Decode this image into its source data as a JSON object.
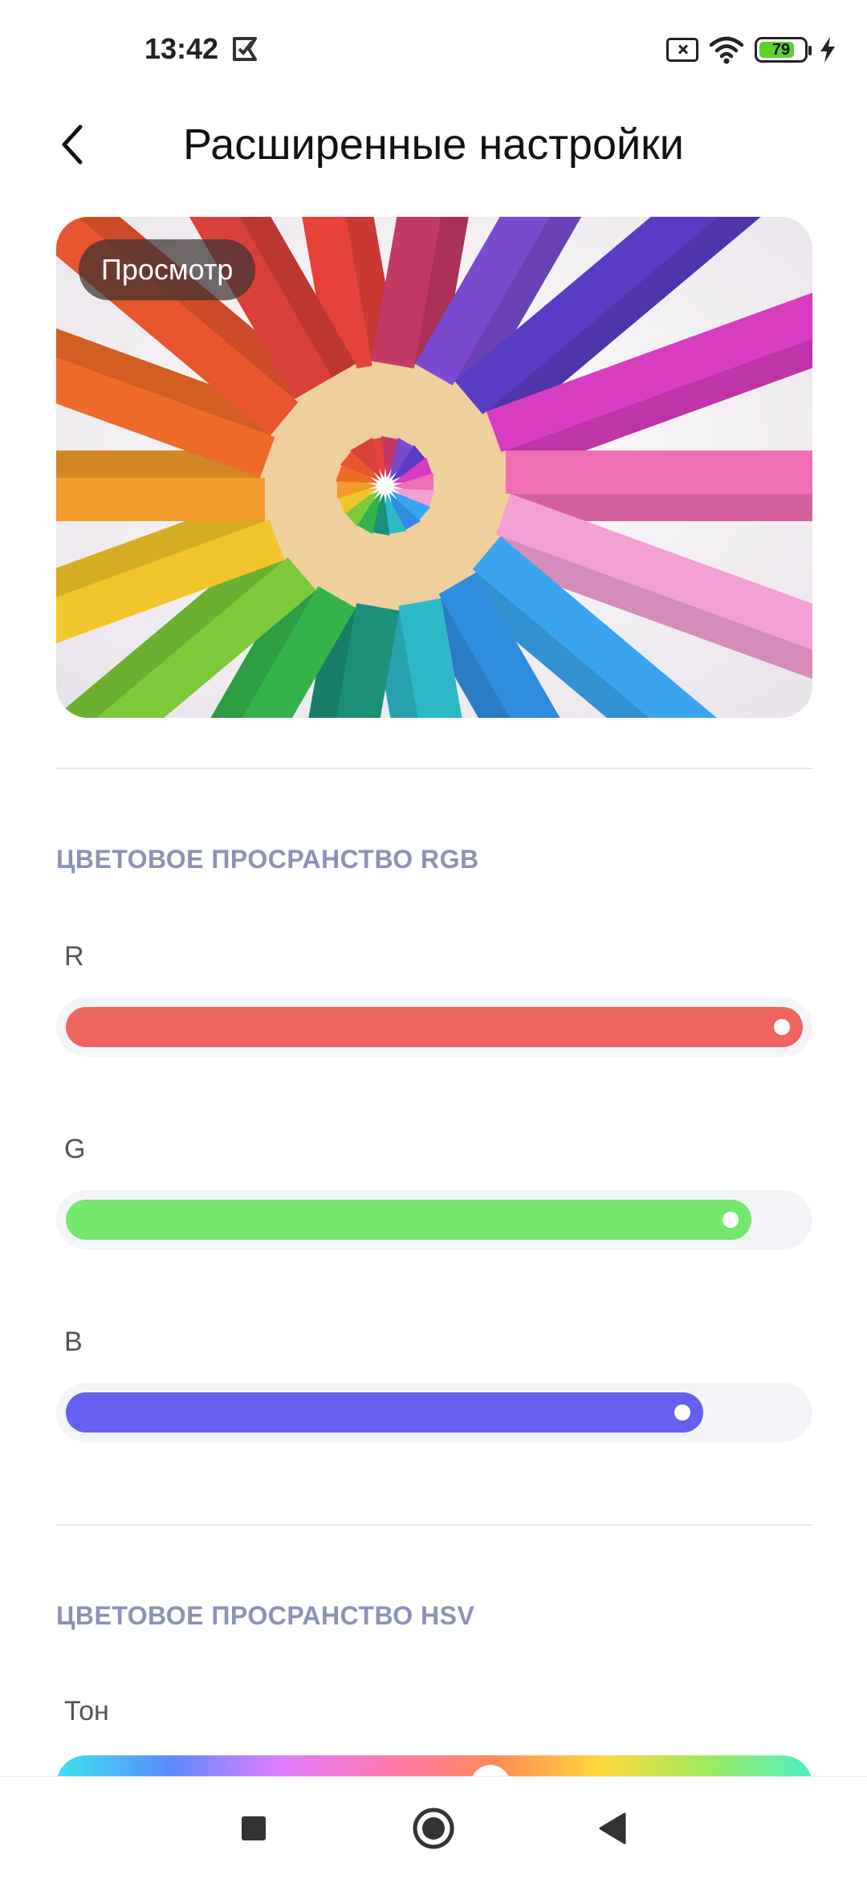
{
  "status_bar": {
    "time": "13:42",
    "battery": "79",
    "battery_color": "#5cd12f"
  },
  "header": {
    "title": "Расширенные настройки"
  },
  "preview": {
    "badge": "Просмотр"
  },
  "rgb_section": {
    "title": "ЦВЕТОВОЕ ПРОСРАНСТВО RGB",
    "sliders": [
      {
        "label": "R",
        "value_fraction": 1.0,
        "color": "#ef6660"
      },
      {
        "label": "G",
        "value_fraction": 0.93,
        "color": "#74e86f"
      },
      {
        "label": "B",
        "value_fraction": 0.865,
        "color": "#6560ef"
      }
    ]
  },
  "hsv_section": {
    "title": "ЦВЕТОВОЕ ПРОСРАНСТВО HSV",
    "hue_label": "Тон"
  },
  "nav": {
    "icons": [
      "recents-square-icon",
      "home-circle-icon",
      "back-triangle-icon"
    ]
  }
}
